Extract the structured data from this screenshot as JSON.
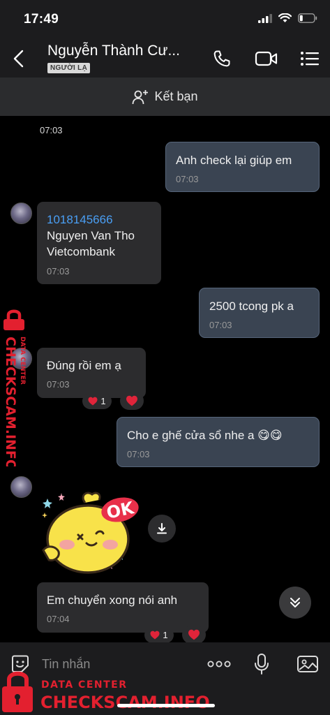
{
  "status_bar": {
    "time": "17:49",
    "battery_icon": "battery-low-icon"
  },
  "header": {
    "contact_name": "Nguyễn Thành Cư...",
    "badge": "NGƯỜI LẠ",
    "icons": [
      "back-icon",
      "phone-icon",
      "video-call-icon",
      "menu-list-icon"
    ]
  },
  "add_friend": {
    "label": "Kết bạn",
    "icon": "add-user-icon"
  },
  "messages": [
    {
      "side": "time",
      "text": "07:03"
    },
    {
      "side": "out",
      "text": "Anh check lại giúp em",
      "time": "07:03"
    },
    {
      "side": "in",
      "lines": [
        "1018145666",
        "Nguyen Van Tho",
        "Vietcombank"
      ],
      "time": "07:03"
    },
    {
      "side": "out",
      "text": "2500 tcong pk a",
      "time": "07:03"
    },
    {
      "side": "in",
      "text": "Đúng rồi em ạ",
      "time": "07:03",
      "reaction_count": "1"
    },
    {
      "side": "out",
      "text": "Cho e ghế cửa sổ nhe a 😋😋",
      "time": "07:03"
    },
    {
      "side": "in",
      "sticker": "OK",
      "sticker_icon": "chick-ok-sticker"
    },
    {
      "side": "in",
      "text": "Em chuyển xong nói anh",
      "time": "07:04",
      "reaction_count": "1"
    }
  ],
  "input_bar": {
    "placeholder": "Tin nhắn",
    "icons": [
      "sticker-icon",
      "more-icon",
      "microphone-icon",
      "image-icon"
    ]
  },
  "watermark": {
    "top": "DATA CENTER",
    "brand": "CHECKSCAM.INFO"
  },
  "colors": {
    "outgoing_bubble": "#3a4452",
    "incoming_bubble": "#2c2c2e",
    "link": "#4a9ff5",
    "heart": "#e0243a",
    "watermark": "#e3202f"
  }
}
